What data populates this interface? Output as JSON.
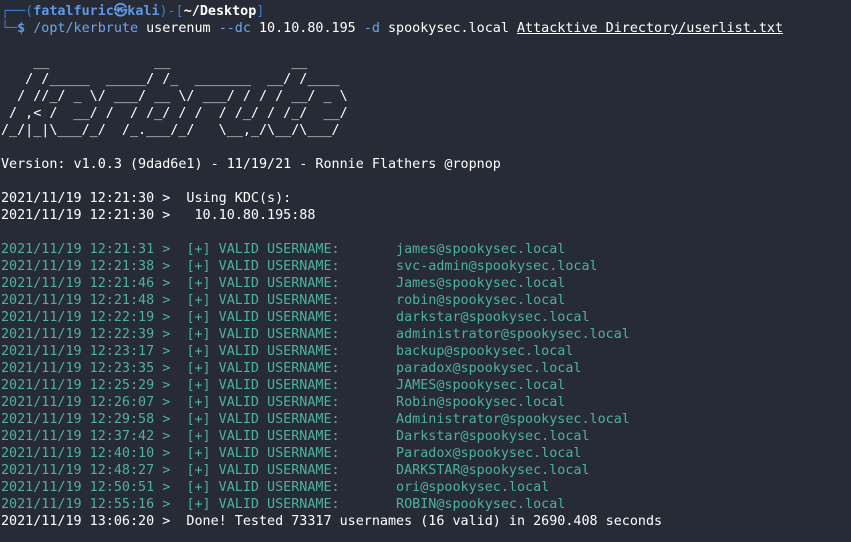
{
  "prompt": {
    "box_top": "┌──(",
    "user_host": "fatalfuric㉿kali",
    "box_mid": ")-[",
    "cwd": "~/Desktop",
    "box_end": "]",
    "box_bottom": "└─",
    "dollar": "$ ",
    "exe": "/opt/kerbrute",
    "sub": " userenum ",
    "flag_dc": "--dc",
    "ip": " 10.10.80.195 ",
    "flag_d": "-d",
    "domain": " spookysec.local ",
    "userlist": "Attacktive Directory/userlist.txt"
  },
  "banner": [
    "    __             __               __     ",
    "   / /_____  _____/ /_  _______  __/ /____ ",
    "  / //_/ _ \\/ ___/ __ \\/ ___/ / / / __/ _ \\",
    " / ,< /  __/ /  / /_/ / /  / /_/ / /_/  __/",
    "/_/|_|\\___/_/  /_.___/_/   \\__,_/\\__/\\___/ "
  ],
  "version": "Version: v1.0.3 (9dad6e1) - 11/19/21 - Ronnie Flathers @ropnop",
  "kdc": [
    "2021/11/19 12:21:30 >  Using KDC(s):",
    "2021/11/19 12:21:30 >  \t10.10.80.195:88"
  ],
  "results": [
    {
      "time": "2021/11/19 12:21:31 >  ",
      "tag": "[+] VALID USERNAME:\t ",
      "user": "james@spookysec.local"
    },
    {
      "time": "2021/11/19 12:21:38 >  ",
      "tag": "[+] VALID USERNAME:\t ",
      "user": "svc-admin@spookysec.local"
    },
    {
      "time": "2021/11/19 12:21:46 >  ",
      "tag": "[+] VALID USERNAME:\t ",
      "user": "James@spookysec.local"
    },
    {
      "time": "2021/11/19 12:21:48 >  ",
      "tag": "[+] VALID USERNAME:\t ",
      "user": "robin@spookysec.local"
    },
    {
      "time": "2021/11/19 12:22:19 >  ",
      "tag": "[+] VALID USERNAME:\t ",
      "user": "darkstar@spookysec.local"
    },
    {
      "time": "2021/11/19 12:22:39 >  ",
      "tag": "[+] VALID USERNAME:\t ",
      "user": "administrator@spookysec.local"
    },
    {
      "time": "2021/11/19 12:23:17 >  ",
      "tag": "[+] VALID USERNAME:\t ",
      "user": "backup@spookysec.local"
    },
    {
      "time": "2021/11/19 12:23:35 >  ",
      "tag": "[+] VALID USERNAME:\t ",
      "user": "paradox@spookysec.local"
    },
    {
      "time": "2021/11/19 12:25:29 >  ",
      "tag": "[+] VALID USERNAME:\t ",
      "user": "JAMES@spookysec.local"
    },
    {
      "time": "2021/11/19 12:26:07 >  ",
      "tag": "[+] VALID USERNAME:\t ",
      "user": "Robin@spookysec.local"
    },
    {
      "time": "2021/11/19 12:29:58 >  ",
      "tag": "[+] VALID USERNAME:\t ",
      "user": "Administrator@spookysec.local"
    },
    {
      "time": "2021/11/19 12:37:42 >  ",
      "tag": "[+] VALID USERNAME:\t ",
      "user": "Darkstar@spookysec.local"
    },
    {
      "time": "2021/11/19 12:40:10 >  ",
      "tag": "[+] VALID USERNAME:\t ",
      "user": "Paradox@spookysec.local"
    },
    {
      "time": "2021/11/19 12:48:27 >  ",
      "tag": "[+] VALID USERNAME:\t ",
      "user": "DARKSTAR@spookysec.local"
    },
    {
      "time": "2021/11/19 12:50:51 >  ",
      "tag": "[+] VALID USERNAME:\t ",
      "user": "ori@spookysec.local"
    },
    {
      "time": "2021/11/19 12:55:16 >  ",
      "tag": "[+] VALID USERNAME:\t ",
      "user": "ROBIN@spookysec.local"
    }
  ],
  "done": "2021/11/19 13:06:20 >  Done! Tested 73317 usernames (16 valid) in 2690.408 seconds",
  "colors": {
    "background": "#262b36",
    "prompt_blue": "#5e98e6",
    "valid_green": "#4eb29a",
    "text_white": "#ffffff"
  }
}
